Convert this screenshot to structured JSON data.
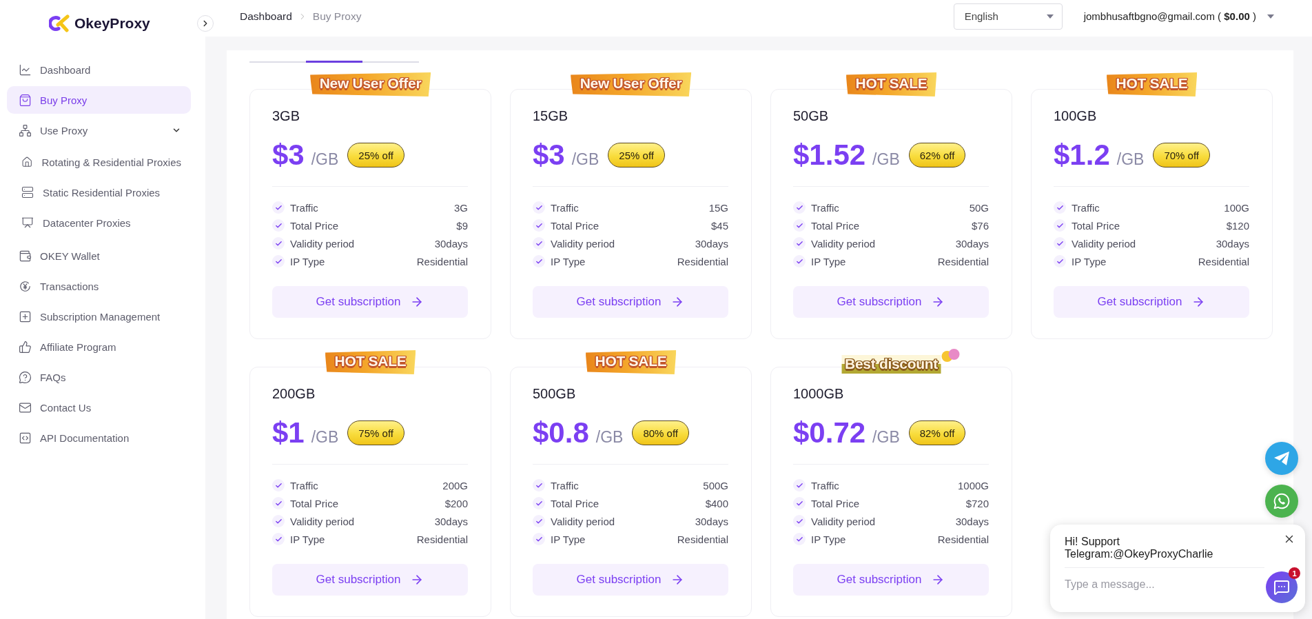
{
  "sidebar": {
    "logo": "OkeyProxy",
    "items": [
      {
        "label": "Dashboard",
        "selected": false
      },
      {
        "label": "Buy Proxy",
        "selected": true
      },
      {
        "label": "Use Proxy",
        "selected": false,
        "expanded": true,
        "children": [
          {
            "label": "Rotating & Residential Proxies",
            "selected": false
          },
          {
            "label": "Static Residential Proxies",
            "selected": false
          },
          {
            "label": "Datacenter Proxies",
            "selected": false
          }
        ]
      },
      {
        "label": "OKEY Wallet",
        "selected": false
      },
      {
        "label": "Transactions",
        "selected": false
      },
      {
        "label": "Subscription Management",
        "selected": false
      },
      {
        "label": "Affiliate Program",
        "selected": false
      },
      {
        "label": "FAQs",
        "selected": false
      },
      {
        "label": "Contact Us",
        "selected": false
      },
      {
        "label": "API Documentation",
        "selected": false
      }
    ]
  },
  "header": {
    "breadcrumb": [
      "Dashboard",
      "Buy Proxy"
    ],
    "language": {
      "value": "English"
    },
    "account": "jombhusaftbgno@gmail.com ( **$0.00** )"
  },
  "tabs": [
    {
      "selected": false
    },
    {
      "selected": true
    },
    {
      "selected": false
    }
  ],
  "plans": [
    {
      "badge": {
        "text": "New User Offer",
        "kind": "ribbon"
      },
      "size": "3GB",
      "price": "$3",
      "unit": "/GB",
      "discount": "25% off",
      "features": [
        {
          "label": "Traffic",
          "value": "3G"
        },
        {
          "label": "Total Price",
          "value": "$9"
        },
        {
          "label": "Validity period",
          "value": "30days"
        },
        {
          "label": "IP Type",
          "value": "Residential"
        }
      ],
      "button": "Get subscription"
    },
    {
      "badge": {
        "text": "New User Offer",
        "kind": "ribbon"
      },
      "size": "15GB",
      "price": "$3",
      "unit": "/GB",
      "discount": "25% off",
      "features": [
        {
          "label": "Traffic",
          "value": "15G"
        },
        {
          "label": "Total Price",
          "value": "$45"
        },
        {
          "label": "Validity period",
          "value": "30days"
        },
        {
          "label": "IP Type",
          "value": "Residential"
        }
      ],
      "button": "Get subscription"
    },
    {
      "badge": {
        "text": "HOT SALE",
        "kind": "ribbon"
      },
      "size": "50GB",
      "price": "$1.52",
      "unit": "/GB",
      "discount": "62% off",
      "features": [
        {
          "label": "Traffic",
          "value": "50G"
        },
        {
          "label": "Total Price",
          "value": "$76"
        },
        {
          "label": "Validity period",
          "value": "30days"
        },
        {
          "label": "IP Type",
          "value": "Residential"
        }
      ],
      "button": "Get subscription"
    },
    {
      "badge": {
        "text": "HOT SALE",
        "kind": "ribbon"
      },
      "size": "100GB",
      "price": "$1.2",
      "unit": "/GB",
      "discount": "70% off",
      "features": [
        {
          "label": "Traffic",
          "value": "100G"
        },
        {
          "label": "Total Price",
          "value": "$120"
        },
        {
          "label": "Validity period",
          "value": "30days"
        },
        {
          "label": "IP Type",
          "value": "Residential"
        }
      ],
      "button": "Get subscription"
    },
    {
      "badge": {
        "text": "HOT SALE",
        "kind": "ribbon"
      },
      "size": "200GB",
      "price": "$1",
      "unit": "/GB",
      "discount": "75% off",
      "features": [
        {
          "label": "Traffic",
          "value": "200G"
        },
        {
          "label": "Total Price",
          "value": "$200"
        },
        {
          "label": "Validity period",
          "value": "30days"
        },
        {
          "label": "IP Type",
          "value": "Residential"
        }
      ],
      "button": "Get subscription"
    },
    {
      "badge": {
        "text": "HOT SALE",
        "kind": "ribbon"
      },
      "size": "500GB",
      "price": "$0.8",
      "unit": "/GB",
      "discount": "80% off",
      "features": [
        {
          "label": "Traffic",
          "value": "500G"
        },
        {
          "label": "Total Price",
          "value": "$400"
        },
        {
          "label": "Validity period",
          "value": "30days"
        },
        {
          "label": "IP Type",
          "value": "Residential"
        }
      ],
      "button": "Get subscription"
    },
    {
      "badge": {
        "text": "Best discount",
        "kind": "balloon"
      },
      "size": "1000GB",
      "price": "$0.72",
      "unit": "/GB",
      "discount": "82% off",
      "features": [
        {
          "label": "Traffic",
          "value": "1000G"
        },
        {
          "label": "Total Price",
          "value": "$720"
        },
        {
          "label": "Validity period",
          "value": "30days"
        },
        {
          "label": "IP Type",
          "value": "Residential"
        }
      ],
      "button": "Get subscription"
    }
  ],
  "chat": {
    "message": "Hi! Support Telegram:@OkeyProxyCharlie",
    "placeholder": "Type a message...",
    "unread": "1"
  }
}
